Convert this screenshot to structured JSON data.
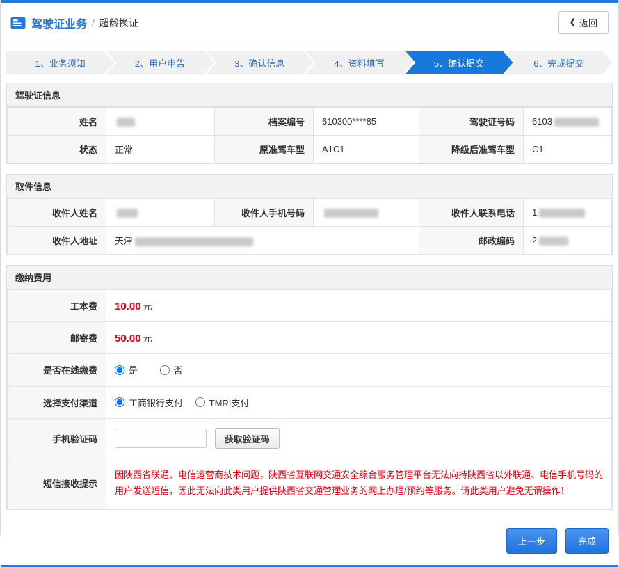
{
  "header": {
    "title": "驾驶证业务",
    "separator": "/",
    "subtitle": "超龄换证",
    "back_label": "返回"
  },
  "steps": [
    "1、业务须知",
    "2、用户申告",
    "3、确认信息",
    "4、资料填写",
    "5、确认提交",
    "6、完成提交"
  ],
  "active_step": "5、确认提交",
  "license": {
    "title": "驾驶证信息",
    "rows": [
      [
        {
          "label": "姓名",
          "value": "",
          "redacted": true
        },
        {
          "label": "档案编号",
          "value": "610300****85",
          "redacted": false
        },
        {
          "label": "驾驶证号码",
          "value": "6103",
          "redacted": true
        }
      ],
      [
        {
          "label": "状态",
          "value": "正常",
          "redacted": false
        },
        {
          "label": "原准驾车型",
          "value": "A1C1",
          "redacted": false
        },
        {
          "label": "降级后准驾车型",
          "value": "C1",
          "redacted": false
        }
      ]
    ]
  },
  "pickup": {
    "title": "取件信息",
    "row1": [
      {
        "label": "收件人姓名",
        "value": "",
        "redacted": true
      },
      {
        "label": "收件人手机号码",
        "value": "",
        "redacted": true
      },
      {
        "label": "收件人联系电话",
        "value": "1",
        "redacted": true
      }
    ],
    "row2": {
      "address_label": "收件人地址",
      "address_value": "天津",
      "address_redacted": true,
      "zip_label": "邮政编码",
      "zip_value": "2",
      "zip_redacted": true
    }
  },
  "fees": {
    "title": "缴纳费用",
    "production_fee": {
      "label": "工本费",
      "amount": "10.00",
      "unit": "元"
    },
    "mailing_fee": {
      "label": "邮寄费",
      "amount": "50.00",
      "unit": "元"
    },
    "online_pay": {
      "label": "是否在线缴费",
      "options": [
        {
          "label": "是",
          "checked": true
        },
        {
          "label": "否",
          "checked": false
        }
      ]
    },
    "channel": {
      "label": "选择支付渠道",
      "options": [
        {
          "label": "工商银行支付",
          "checked": true
        },
        {
          "label": "TMRI支付",
          "checked": false
        }
      ]
    },
    "sms_code": {
      "label": "手机验证码",
      "input_value": "",
      "button_label": "获取验证码"
    },
    "sms_note": {
      "label": "短信接收提示",
      "text": "因陕西省联通、电信运营商技术问题，陕西省互联网交通安全综合服务管理平台无法向持陕西省以外联通、电信手机号码的用户发送短信，因此无法向此类用户提供陕西省交通管理业务的网上办理/预约等服务。请此类用户避免无谓操作！"
    }
  },
  "actions": {
    "prev": "上一步",
    "finish": "完成"
  },
  "colors": {
    "accent": "#2878d8",
    "step_active": "#1879dd",
    "fee_red": "#e60012"
  }
}
